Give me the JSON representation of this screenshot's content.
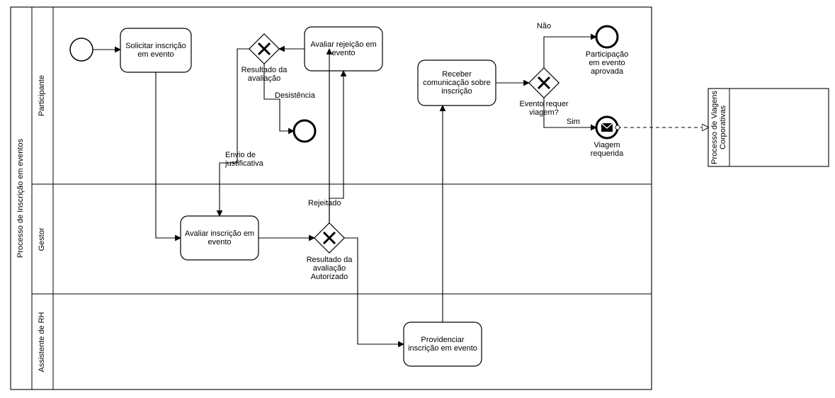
{
  "pool": {
    "title": "Processo de Inscrição em eventos"
  },
  "lanes": {
    "l1": "Participante",
    "l2": "Gestor",
    "l3": "Assistente de RH"
  },
  "tasks": {
    "solicitar": "Solicitar inscrição em evento",
    "avaliarRej": "Avaliar rejeição em evento",
    "avaliarInsc": "Avaliar inscrição em evento",
    "providenciar": "Providenciar inscrição em evento",
    "receber": "Receber comunicação sobre inscrição"
  },
  "gateways": {
    "g1": "Resultado da avaliação",
    "g2": "Resultado da avaliação",
    "g3": "Evento requer viagem?"
  },
  "flows": {
    "desistencia": "Desistência",
    "envioJust": "Envio de justificativa",
    "rejeitado": "Rejeitado",
    "autorizado": "Autorizado",
    "nao": "Não",
    "sim": "Sim"
  },
  "endEvents": {
    "aprovada": "Participação em evento aprovada",
    "viagem": "Viagem requerida"
  },
  "extPool": {
    "title": "Processo de Viagens Corporativas"
  }
}
